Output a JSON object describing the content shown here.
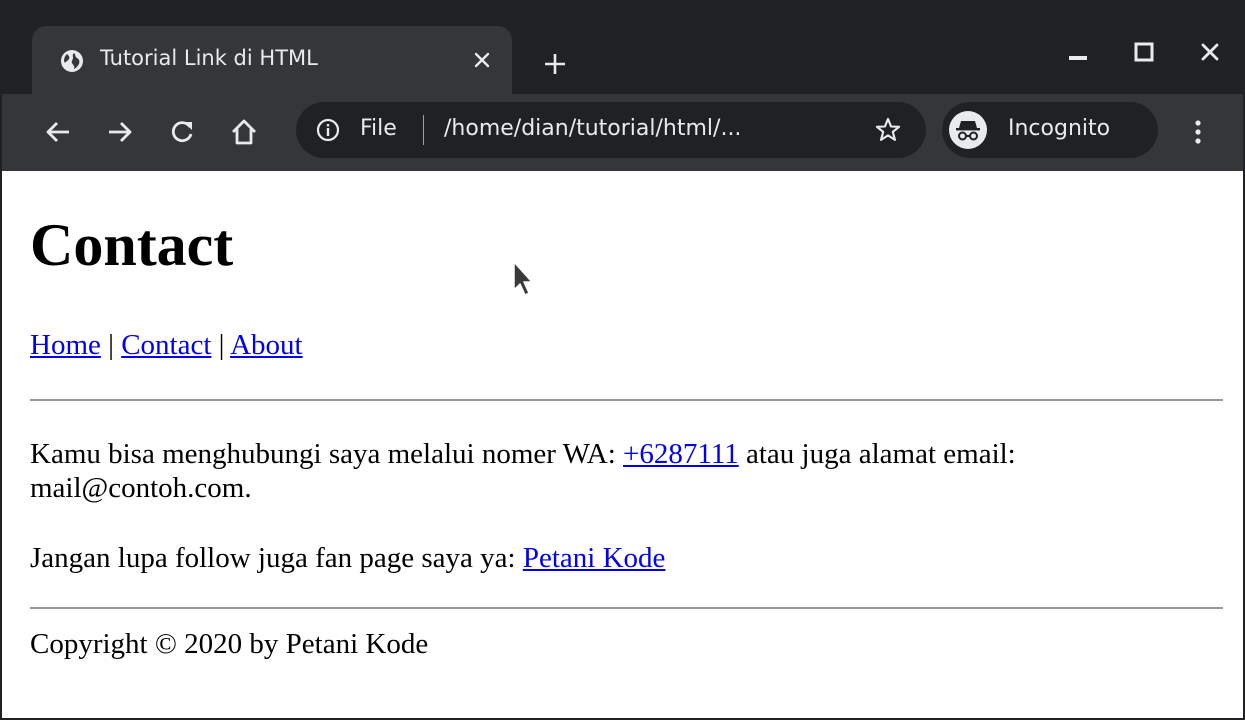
{
  "browser": {
    "tab_title": "Tutorial Link di HTML",
    "url_scheme_label": "File",
    "url": "/home/dian/tutorial/html/...",
    "incognito_label": "Incognito"
  },
  "page": {
    "heading": "Contact",
    "nav": {
      "home": "Home",
      "contact": "Contact",
      "about": "About",
      "separator": " | "
    },
    "contact_paragraph": {
      "text_before": "Kamu bisa menghubungi saya melalui nomer WA: ",
      "wa_link": "+6287111",
      "text_after": " atau juga alamat email: mail@contoh.com."
    },
    "follow_paragraph": {
      "text": "Jangan lupa follow juga fan page saya ya: ",
      "link": "Petani Kode"
    },
    "footer": "Copyright © 2020 by Petani Kode"
  }
}
